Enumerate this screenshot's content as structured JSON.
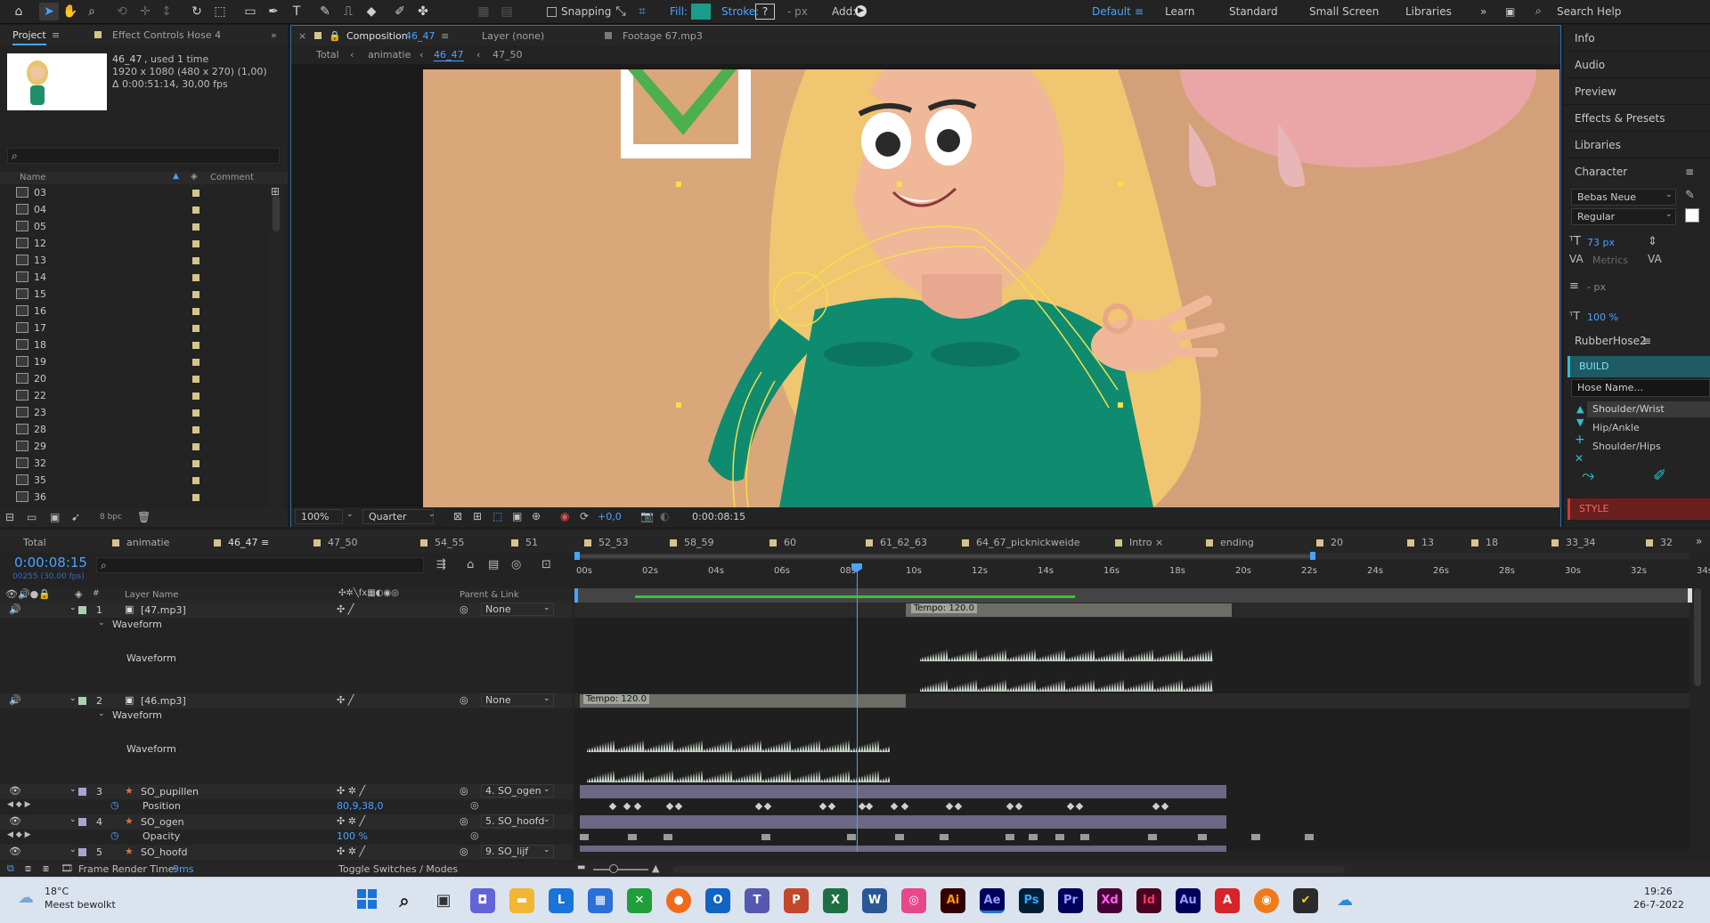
{
  "toolbar": {
    "snapping": "Snapping",
    "fill_label": "Fill:",
    "stroke_label": "Stroke:",
    "stroke_value": "?",
    "px_label": "- px",
    "add_label": "Add:",
    "workspaces": [
      "Default",
      "Learn",
      "Standard",
      "Small Screen",
      "Libraries"
    ],
    "search_placeholder": "Search Help",
    "fill_color": "#1a9e8a"
  },
  "project": {
    "tab_project": "Project",
    "tab_effects": "Effect Controls Hose 4",
    "item_name": "46_47",
    "item_used": ", used 1 time",
    "item_dims": "1920 x 1080  (480 x 270) (1,00)",
    "item_duration": "Δ 0:00:51:14, 30,00 fps",
    "col_name": "Name",
    "col_comment": "Comment",
    "items": [
      "03",
      "04",
      "05",
      "12",
      "13",
      "14",
      "15",
      "16",
      "17",
      "18",
      "19",
      "20",
      "22",
      "23",
      "28",
      "29",
      "32",
      "35",
      "36"
    ],
    "bpc": "8 bpc"
  },
  "viewer": {
    "tab_comp_prefix": "Composition",
    "tab_comp_name": "46_47",
    "tab_layer": "Layer (none)",
    "tab_footage": "Footage 67.mp3",
    "crumbs": [
      "Total",
      "animatie",
      "46_47",
      "47_50"
    ],
    "zoom": "100%",
    "quality": "Quarter",
    "exposure": "+0,0",
    "timecode": "0:00:08:15"
  },
  "right_panel": {
    "items": [
      "Info",
      "Audio",
      "Preview",
      "Effects & Presets",
      "Libraries"
    ],
    "character_title": "Character",
    "font": "Bebas Neue",
    "font_style": "Regular",
    "font_size": "73 px",
    "kerning": "Metrics",
    "leading_unit": "- px",
    "scale": "100 %",
    "rubberhose_title": "RubberHose2",
    "build_label": "BUILD",
    "hose_name_placeholder": "Hose Name...",
    "options": [
      "Shoulder/Wrist",
      "Hip/Ankle",
      "Shoulder/Hips"
    ],
    "style_label": "STYLE"
  },
  "timeline": {
    "tabs": [
      "Total",
      "animatie",
      "46_47",
      "47_50",
      "54_55",
      "51",
      "52_53",
      "58_59",
      "60",
      "61_62_63",
      "64_67_picknickweide",
      "Intro",
      "ending",
      "20",
      "13",
      "18",
      "33_34",
      "32"
    ],
    "timecode": "0:00:08:15",
    "frame_info": "00255 (30.00 fps)",
    "col_layer_name": "Layer Name",
    "col_parent": "Parent & Link",
    "ruler": [
      "00s",
      "02s",
      "04s",
      "06s",
      "08s",
      "10s",
      "12s",
      "14s",
      "16s",
      "18s",
      "20s",
      "22s",
      "24s",
      "26s",
      "28s",
      "30s",
      "32s",
      "34s"
    ],
    "layers": [
      {
        "num": "1",
        "name": "[47.mp3]",
        "parent": "None"
      },
      {
        "num": "2",
        "name": "[46.mp3]",
        "parent": "None"
      },
      {
        "num": "3",
        "name": "SO_pupillen",
        "parent": "4. SO_ogen"
      },
      {
        "num": "4",
        "name": "SO_ogen",
        "parent": "5. SO_hoofd"
      },
      {
        "num": "5",
        "name": "SO_hoofd",
        "parent": "9. SO_lijf"
      }
    ],
    "waveform": "Waveform",
    "tempo": "Tempo: 120.0",
    "prop_position": "Position",
    "prop_position_value": "80,9,38,0",
    "prop_opacity": "Opacity",
    "prop_opacity_value": "100 %",
    "frame_render": "Frame Render Time:",
    "frame_render_value": "9ms",
    "toggle": "Toggle Switches / Modes"
  },
  "taskbar": {
    "temp": "18°C",
    "weather": "Meest bewolkt",
    "time": "19:26",
    "date": "26-7-2022"
  }
}
